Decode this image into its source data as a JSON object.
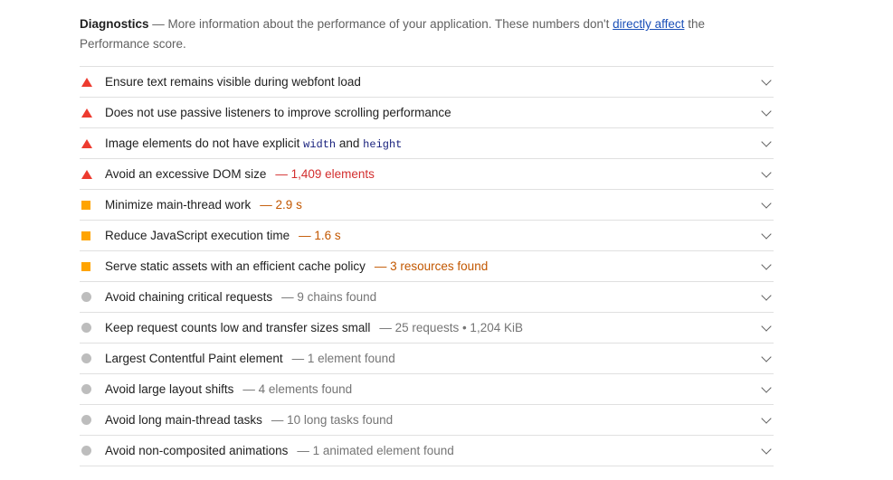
{
  "header": {
    "title": "Diagnostics",
    "desc_before": " — More information about the performance of your application. These numbers don't ",
    "link": "directly affect",
    "desc_after": " the Performance score."
  },
  "audits": [
    {
      "icon": "fail-triangle-icon",
      "label": "Ensure text remains visible during webfont load",
      "display": ""
    },
    {
      "icon": "fail-triangle-icon",
      "label": "Does not use passive listeners to improve scrolling performance",
      "display": ""
    },
    {
      "icon": "fail-triangle-icon",
      "label_pre": "Image elements do not have explicit ",
      "code1": "width",
      "label_mid": " and ",
      "code2": "height",
      "display": ""
    },
    {
      "icon": "fail-triangle-icon",
      "label": "Avoid an excessive DOM size",
      "display": "— 1,409 elements",
      "display_color": "red"
    },
    {
      "icon": "average-square-icon",
      "label": "Minimize main-thread work",
      "display": "— 2.9 s",
      "display_color": "orange"
    },
    {
      "icon": "average-square-icon",
      "label": "Reduce JavaScript execution time",
      "display": "— 1.6 s",
      "display_color": "orange"
    },
    {
      "icon": "average-square-icon",
      "label": "Serve static assets with an efficient cache policy",
      "display": "— 3 resources found",
      "display_color": "orange"
    },
    {
      "icon": "info-circle-icon",
      "label": "Avoid chaining critical requests",
      "display": "— 9 chains found",
      "display_color": "gray"
    },
    {
      "icon": "info-circle-icon",
      "label": "Keep request counts low and transfer sizes small",
      "display": "— 25 requests • 1,204 KiB",
      "display_color": "gray"
    },
    {
      "icon": "info-circle-icon",
      "label": "Largest Contentful Paint element",
      "display": "— 1 element found",
      "display_color": "gray"
    },
    {
      "icon": "info-circle-icon",
      "label": "Avoid large layout shifts",
      "display": "— 4 elements found",
      "display_color": "gray"
    },
    {
      "icon": "info-circle-icon",
      "label": "Avoid long main-thread tasks",
      "display": "— 10 long tasks found",
      "display_color": "gray"
    },
    {
      "icon": "info-circle-icon",
      "label": "Avoid non-composited animations",
      "display": "— 1 animated element found",
      "display_color": "gray"
    }
  ],
  "colors": {
    "fail": "#ed3b2f",
    "average": "#ffa400",
    "info": "#bdbdbd",
    "link": "#1a4fb8"
  }
}
